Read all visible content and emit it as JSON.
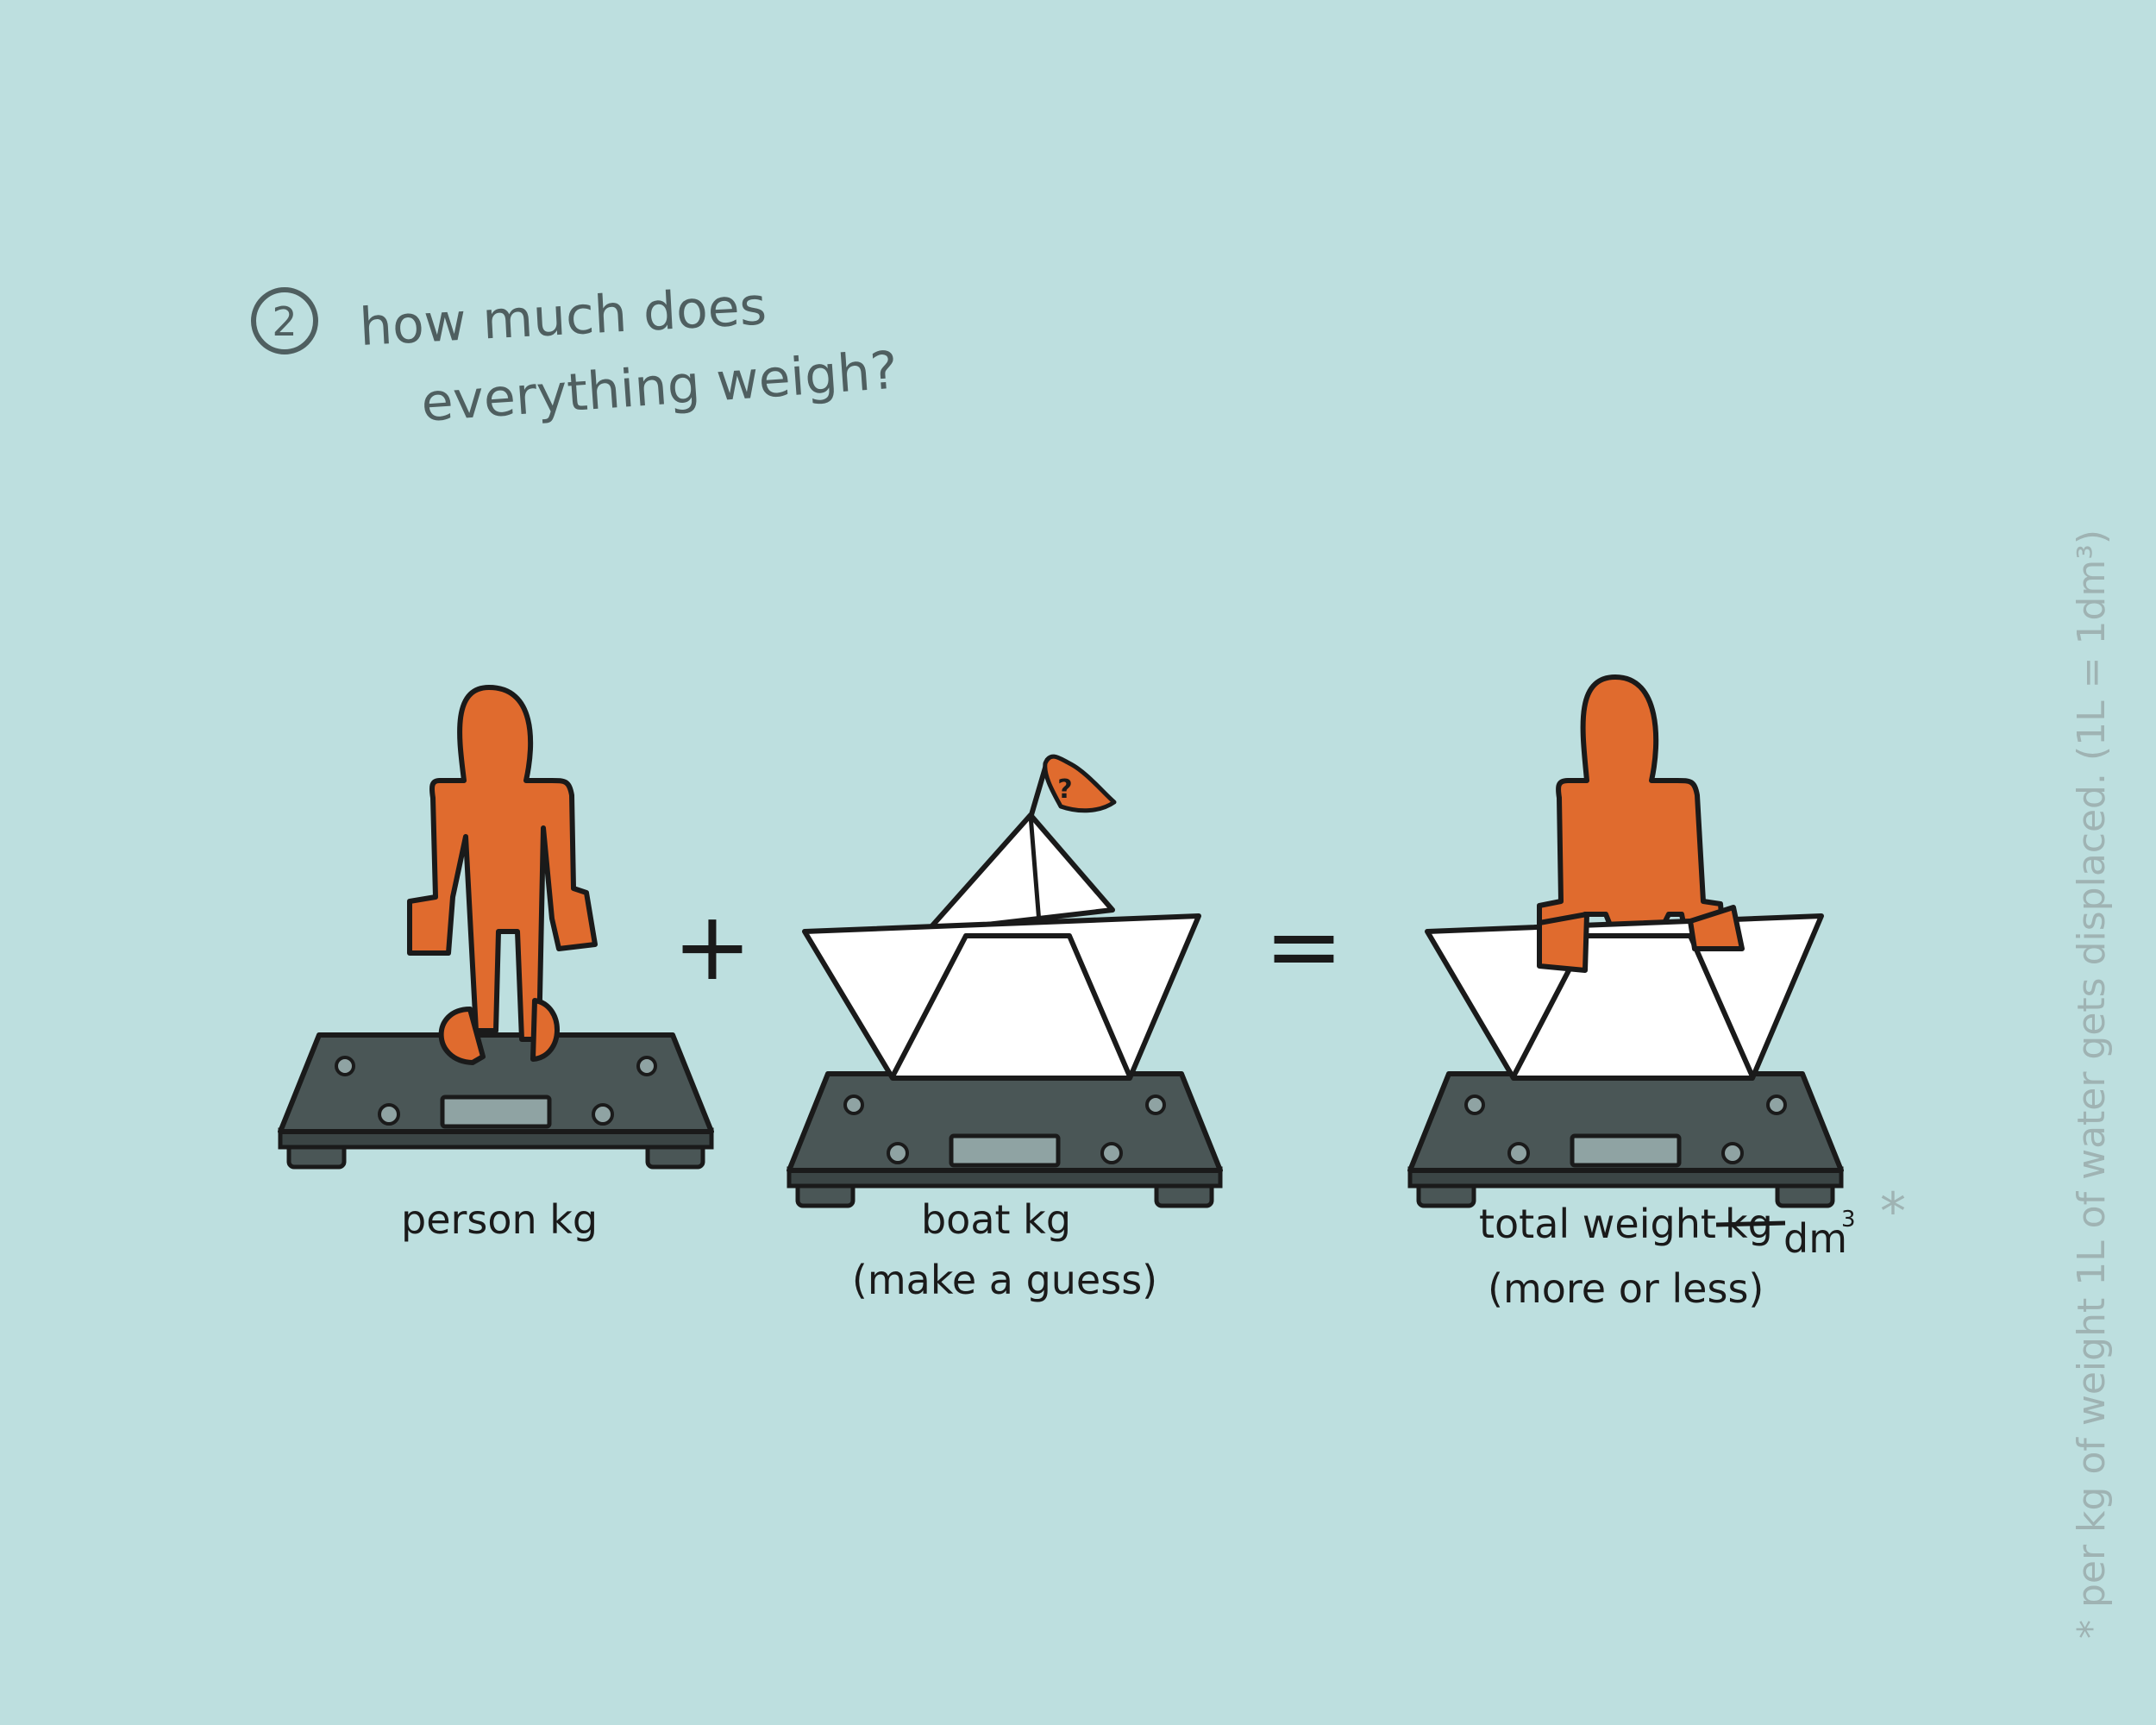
{
  "step": {
    "number": "2",
    "title_line1": "how much does",
    "title_line2": "everything weigh?"
  },
  "operators": {
    "plus": "+",
    "equals": "="
  },
  "person": {
    "caption": "person kg"
  },
  "boat": {
    "caption_line1": "boat kg",
    "caption_line2": "(make a guess)",
    "flag_mark": "?"
  },
  "total": {
    "caption_word": "total weight",
    "crossed_unit": "kg",
    "new_unit": "dm",
    "exponent": "3",
    "asterisk": "*",
    "caption_line2": "(more or less)"
  },
  "footnote": {
    "text": "* per kg of weight 1L of water gets displaced. (1L = 1dm³)"
  },
  "colors": {
    "background": "#bddfdf",
    "figure_orange": "#e06b2e",
    "scale_dark": "#4a5656",
    "scale_display": "#8fa3a3",
    "paper_white": "#ffffff",
    "ink": "#1a1a1a"
  }
}
